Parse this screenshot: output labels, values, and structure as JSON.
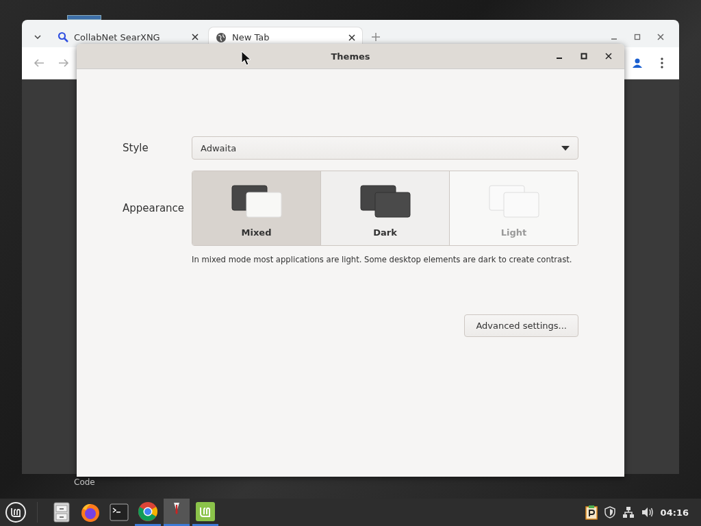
{
  "desktop": {
    "icon_label": "Code"
  },
  "browser": {
    "tabs": [
      {
        "title": "CollabNet SearXNG",
        "kind": "search",
        "selected": false
      },
      {
        "title": "New Tab",
        "kind": "globe",
        "selected": true
      }
    ]
  },
  "dialog": {
    "title": "Themes",
    "style": {
      "label": "Style",
      "value": "Adwaita"
    },
    "appearance": {
      "label": "Appearance",
      "options": [
        {
          "name": "Mixed",
          "kind": "mixed",
          "selected": true
        },
        {
          "name": "Dark",
          "kind": "dark",
          "selected": false
        },
        {
          "name": "Light",
          "kind": "light",
          "selected": false
        }
      ],
      "description": "In mixed mode most applications are light. Some desktop elements are dark to create contrast."
    },
    "button": "Advanced settings..."
  },
  "taskbar": {
    "apps": [
      {
        "kind": "files",
        "running": false,
        "focused": false
      },
      {
        "kind": "firefox",
        "running": false,
        "focused": false
      },
      {
        "kind": "terminal",
        "running": false,
        "focused": false
      },
      {
        "kind": "chrome",
        "running": true,
        "focused": false
      },
      {
        "kind": "themes",
        "running": true,
        "focused": true
      },
      {
        "kind": "mint",
        "running": true,
        "focused": false
      }
    ],
    "clock": "04:16"
  }
}
